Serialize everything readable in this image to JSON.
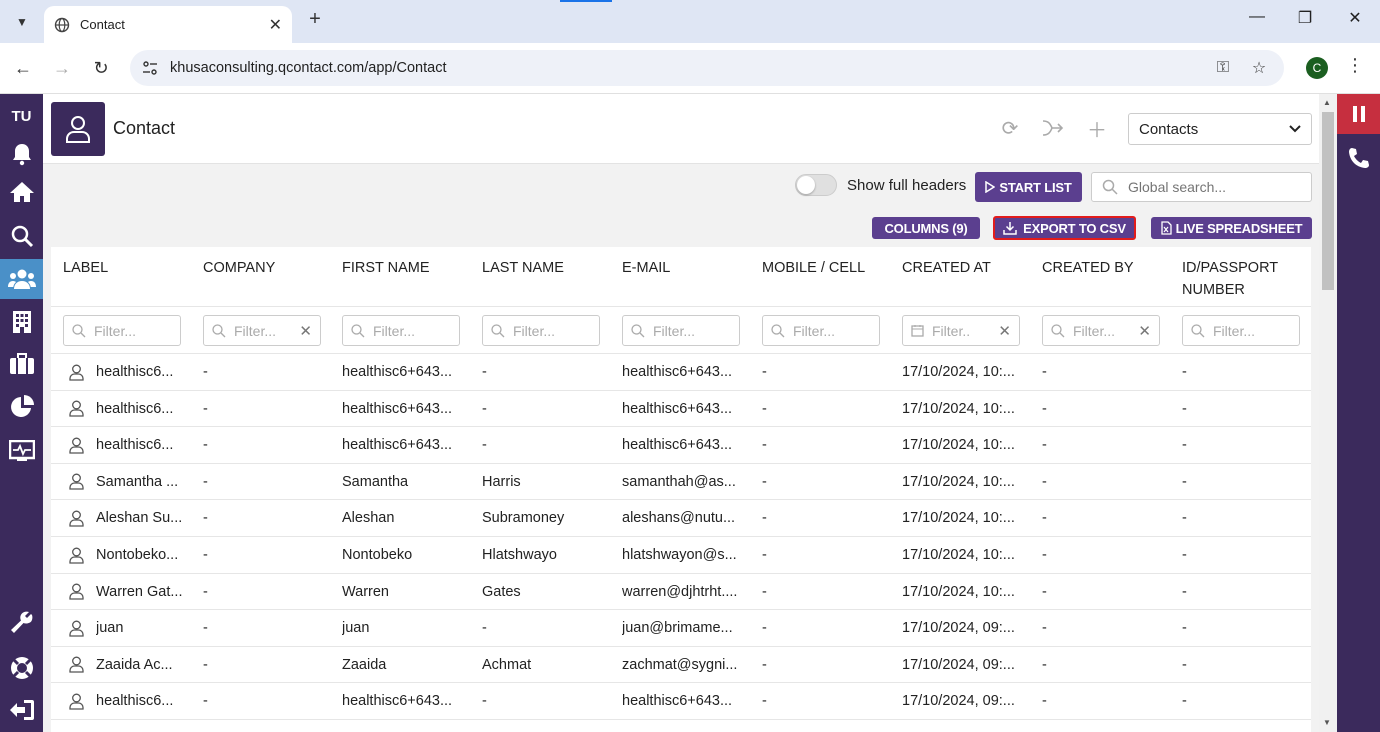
{
  "browser": {
    "tab_title": "Contact",
    "new_tab": "+",
    "url": "khusaconsulting.qcontact.com/app/Contact",
    "profile_initial": "C"
  },
  "sidebar": {
    "badge": "TU",
    "items": [
      "notifications",
      "home",
      "search",
      "contacts",
      "organisations",
      "cases",
      "reports",
      "monitor",
      "settings",
      "help",
      "logout"
    ]
  },
  "header": {
    "title": "Contact",
    "view_select": "Contacts"
  },
  "controls": {
    "toggle_label": "Show full headers",
    "start_list": "START LIST",
    "global_search_placeholder": "Global search...",
    "columns_btn": "COLUMNS (9)",
    "export_btn": "EXPORT TO CSV",
    "live_btn": "LIVE SPREADSHEET"
  },
  "table": {
    "columns": [
      "LABEL",
      "COMPANY",
      "FIRST NAME",
      "LAST NAME",
      "E-MAIL",
      "MOBILE / CELL",
      "CREATED AT",
      "CREATED BY",
      "ID/PASSPORT NUMBER"
    ],
    "filter_placeholder": "Filter...",
    "filter_placeholder_short": "Filter..",
    "rows": [
      [
        "healthisc6...",
        "-",
        "healthisc6+643...",
        "-",
        "healthisc6+643...",
        "-",
        "17/10/2024, 10:...",
        "-",
        "-"
      ],
      [
        "healthisc6...",
        "-",
        "healthisc6+643...",
        "-",
        "healthisc6+643...",
        "-",
        "17/10/2024, 10:...",
        "-",
        "-"
      ],
      [
        "healthisc6...",
        "-",
        "healthisc6+643...",
        "-",
        "healthisc6+643...",
        "-",
        "17/10/2024, 10:...",
        "-",
        "-"
      ],
      [
        "Samantha ...",
        "-",
        "Samantha",
        "Harris",
        "samanthah@as...",
        "-",
        "17/10/2024, 10:...",
        "-",
        "-"
      ],
      [
        "Aleshan Su...",
        "-",
        "Aleshan",
        "Subramoney",
        "aleshans@nutu...",
        "-",
        "17/10/2024, 10:...",
        "-",
        "-"
      ],
      [
        "Nontobeko...",
        "-",
        "Nontobeko",
        "Hlatshwayo",
        "hlatshwayon@s...",
        "-",
        "17/10/2024, 10:...",
        "-",
        "-"
      ],
      [
        "Warren Gat...",
        "-",
        "Warren",
        "Gates",
        "warren@djhtrht....",
        "-",
        "17/10/2024, 10:...",
        "-",
        "-"
      ],
      [
        "juan",
        "-",
        "juan",
        "-",
        "juan@brimame...",
        "-",
        "17/10/2024, 09:...",
        "-",
        "-"
      ],
      [
        "Zaaida Ac...",
        "-",
        "Zaaida",
        "Achmat",
        "zachmat@sygni...",
        "-",
        "17/10/2024, 09:...",
        "-",
        "-"
      ],
      [
        "healthisc6...",
        "-",
        "healthisc6+643...",
        "-",
        "healthisc6+643...",
        "-",
        "17/10/2024, 09:...",
        "-",
        "-"
      ]
    ]
  },
  "colors": {
    "brand_purple": "#3b2a5c",
    "button_purple": "#5b3f8f",
    "active_blue": "#4a90c8",
    "pause_red": "#c62f3f",
    "highlight_red": "#e21c1c"
  }
}
